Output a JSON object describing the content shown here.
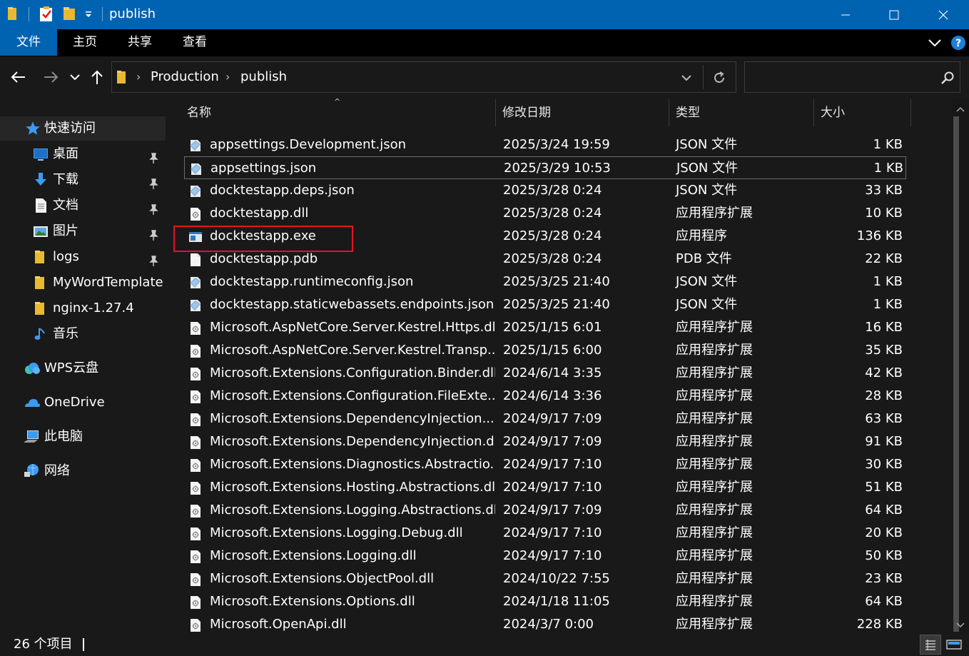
{
  "window": {
    "title": "publish"
  },
  "ribbon": {
    "tabs": [
      "文件",
      "主页",
      "共享",
      "查看"
    ]
  },
  "address": {
    "crumbs": [
      "Production",
      "publish"
    ]
  },
  "search": {
    "placeholder": ""
  },
  "sidebar": {
    "items": [
      {
        "label": "快速访问",
        "icon": "star-icon"
      },
      {
        "label": "桌面",
        "icon": "desktop-icon",
        "pinned": true
      },
      {
        "label": "下载",
        "icon": "download-icon",
        "pinned": true
      },
      {
        "label": "文档",
        "icon": "document-icon",
        "pinned": true
      },
      {
        "label": "图片",
        "icon": "pictures-icon",
        "pinned": true
      },
      {
        "label": "logs",
        "icon": "folder-icon",
        "pinned": true
      },
      {
        "label": "MyWordTemplate",
        "icon": "folder-icon"
      },
      {
        "label": "nginx-1.27.4",
        "icon": "folder-icon"
      },
      {
        "label": "音乐",
        "icon": "music-icon"
      },
      {
        "label": "WPS云盘",
        "icon": "cloud-icon"
      },
      {
        "label": "OneDrive",
        "icon": "onedrive-icon"
      },
      {
        "label": "此电脑",
        "icon": "computer-icon"
      },
      {
        "label": "网络",
        "icon": "network-icon"
      }
    ]
  },
  "columns": {
    "name": "名称",
    "date": "修改日期",
    "type": "类型",
    "size": "大小"
  },
  "files": [
    {
      "name": "appsettings.Development.json",
      "date": "2025/3/24 19:59",
      "type": "JSON 文件",
      "size": "1 KB",
      "icon": "json-file-icon"
    },
    {
      "name": "appsettings.json",
      "date": "2025/3/29 10:53",
      "type": "JSON 文件",
      "size": "1 KB",
      "icon": "json-file-icon"
    },
    {
      "name": "docktestapp.deps.json",
      "date": "2025/3/28 0:24",
      "type": "JSON 文件",
      "size": "33 KB",
      "icon": "json-file-icon"
    },
    {
      "name": "docktestapp.dll",
      "date": "2025/3/28 0:24",
      "type": "应用程序扩展",
      "size": "10 KB",
      "icon": "dll-file-icon"
    },
    {
      "name": "docktestapp.exe",
      "date": "2025/3/28 0:24",
      "type": "应用程序",
      "size": "136 KB",
      "icon": "exe-file-icon"
    },
    {
      "name": "docktestapp.pdb",
      "date": "2025/3/28 0:24",
      "type": "PDB 文件",
      "size": "22 KB",
      "icon": "blank-file-icon"
    },
    {
      "name": "docktestapp.runtimeconfig.json",
      "date": "2025/3/25 21:40",
      "type": "JSON 文件",
      "size": "1 KB",
      "icon": "json-file-icon"
    },
    {
      "name": "docktestapp.staticwebassets.endpoints.json",
      "date": "2025/3/25 21:40",
      "type": "JSON 文件",
      "size": "1 KB",
      "icon": "json-file-icon"
    },
    {
      "name": "Microsoft.AspNetCore.Server.Kestrel.Https.dll",
      "date": "2025/1/15 6:01",
      "type": "应用程序扩展",
      "size": "16 KB",
      "icon": "dll-file-icon"
    },
    {
      "name": "Microsoft.AspNetCore.Server.Kestrel.Transp...",
      "date": "2025/1/15 6:00",
      "type": "应用程序扩展",
      "size": "35 KB",
      "icon": "dll-file-icon"
    },
    {
      "name": "Microsoft.Extensions.Configuration.Binder.dll",
      "date": "2024/6/14 3:35",
      "type": "应用程序扩展",
      "size": "42 KB",
      "icon": "dll-file-icon"
    },
    {
      "name": "Microsoft.Extensions.Configuration.FileExte...",
      "date": "2024/6/14 3:36",
      "type": "应用程序扩展",
      "size": "28 KB",
      "icon": "dll-file-icon"
    },
    {
      "name": "Microsoft.Extensions.DependencyInjection....",
      "date": "2024/9/17 7:09",
      "type": "应用程序扩展",
      "size": "63 KB",
      "icon": "dll-file-icon"
    },
    {
      "name": "Microsoft.Extensions.DependencyInjection.dll",
      "date": "2024/9/17 7:09",
      "type": "应用程序扩展",
      "size": "91 KB",
      "icon": "dll-file-icon"
    },
    {
      "name": "Microsoft.Extensions.Diagnostics.Abstractio...",
      "date": "2024/9/17 7:10",
      "type": "应用程序扩展",
      "size": "30 KB",
      "icon": "dll-file-icon"
    },
    {
      "name": "Microsoft.Extensions.Hosting.Abstractions.dll",
      "date": "2024/9/17 7:10",
      "type": "应用程序扩展",
      "size": "51 KB",
      "icon": "dll-file-icon"
    },
    {
      "name": "Microsoft.Extensions.Logging.Abstractions.dll",
      "date": "2024/9/17 7:09",
      "type": "应用程序扩展",
      "size": "64 KB",
      "icon": "dll-file-icon"
    },
    {
      "name": "Microsoft.Extensions.Logging.Debug.dll",
      "date": "2024/9/17 7:10",
      "type": "应用程序扩展",
      "size": "20 KB",
      "icon": "dll-file-icon"
    },
    {
      "name": "Microsoft.Extensions.Logging.dll",
      "date": "2024/9/17 7:10",
      "type": "应用程序扩展",
      "size": "50 KB",
      "icon": "dll-file-icon"
    },
    {
      "name": "Microsoft.Extensions.ObjectPool.dll",
      "date": "2024/10/22 7:55",
      "type": "应用程序扩展",
      "size": "23 KB",
      "icon": "dll-file-icon"
    },
    {
      "name": "Microsoft.Extensions.Options.dll",
      "date": "2024/1/18 11:05",
      "type": "应用程序扩展",
      "size": "64 KB",
      "icon": "dll-file-icon"
    },
    {
      "name": "Microsoft.OpenApi.dll",
      "date": "2024/3/7 0:00",
      "type": "应用程序扩展",
      "size": "228 KB",
      "icon": "dll-file-icon"
    }
  ],
  "status": {
    "count": "26 个项目"
  },
  "colors": {
    "accent": "#0063b1",
    "highlight": "#e81123",
    "background": "#191919"
  }
}
